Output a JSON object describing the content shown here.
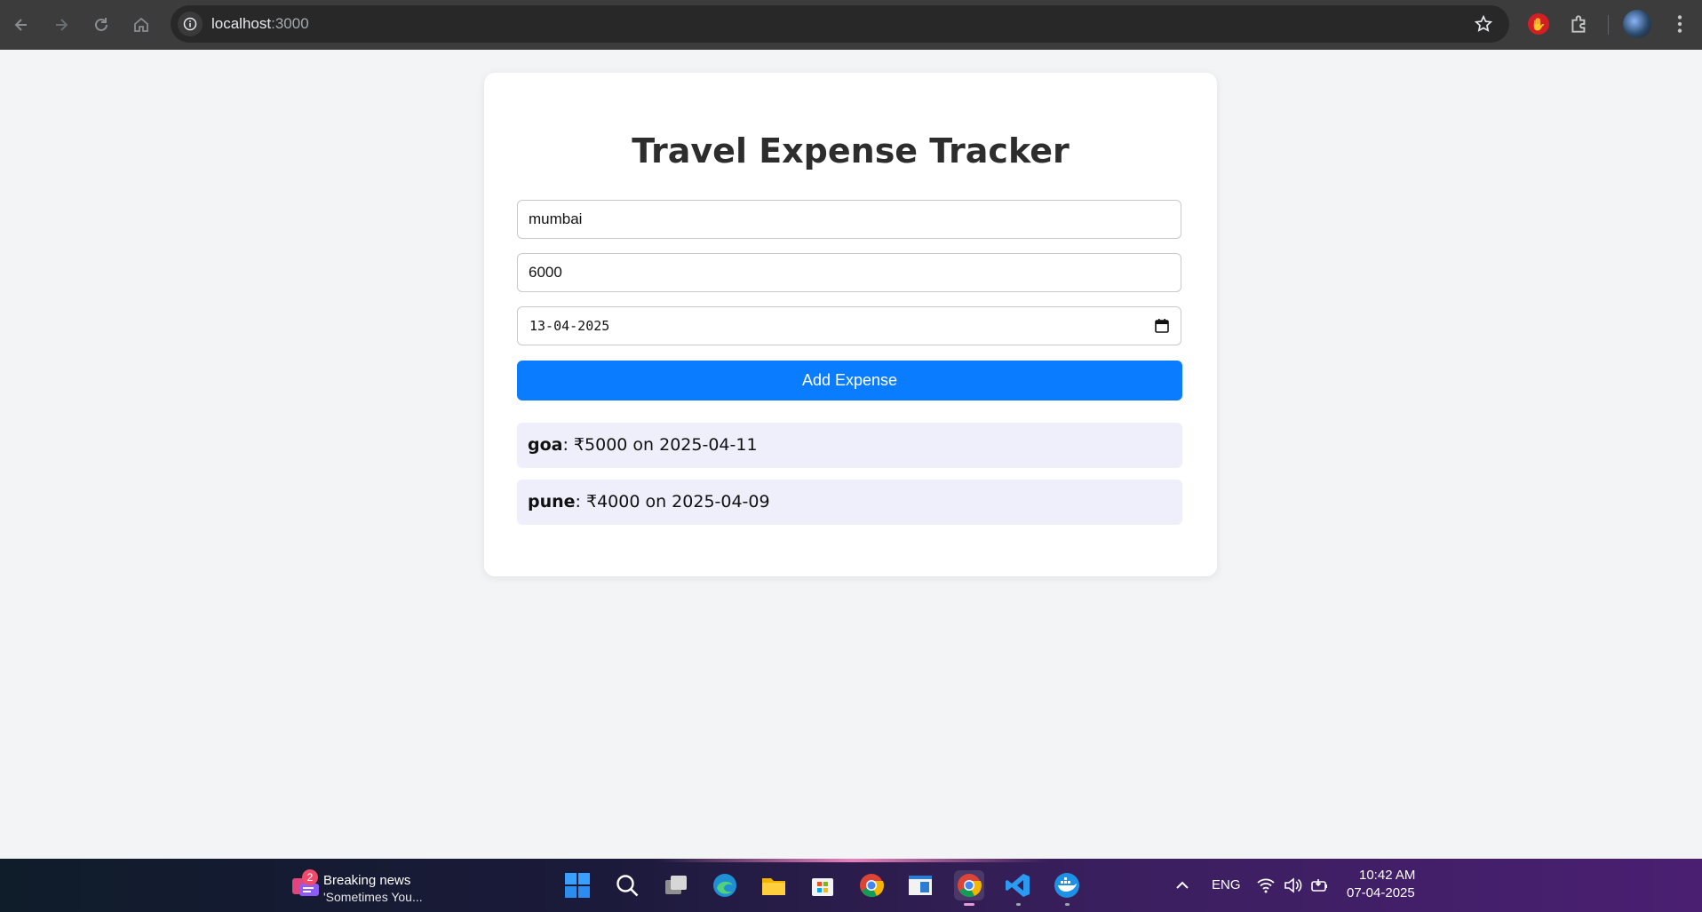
{
  "browser": {
    "url_host": "localhost",
    "url_port": ":3000"
  },
  "page": {
    "title": "Travel Expense Tracker",
    "form": {
      "destination_value": "mumbai",
      "amount_value": "6000",
      "date_value": "13-04-2025",
      "submit_label": "Add Expense"
    },
    "expenses": [
      {
        "place": "goa",
        "detail": ": ₹5000 on 2025-04-11"
      },
      {
        "place": "pune",
        "detail": ": ₹4000 on 2025-04-09"
      }
    ],
    "colors": {
      "accent": "#0a7cff",
      "expense_bg": "#efeefb",
      "page_bg": "#f3f4f6"
    }
  },
  "taskbar": {
    "news_badge": "2",
    "news_title": "Breaking news",
    "news_subtitle": "'Sometimes You...",
    "language": "ENG",
    "time": "10:42 AM",
    "date": "07-04-2025",
    "icons": [
      "start-icon",
      "search-icon",
      "task-view-icon",
      "edge-icon",
      "file-explorer-icon",
      "store-icon",
      "chrome-icon",
      "notepad-icon",
      "chrome-active-icon",
      "vscode-icon",
      "docker-icon"
    ]
  }
}
